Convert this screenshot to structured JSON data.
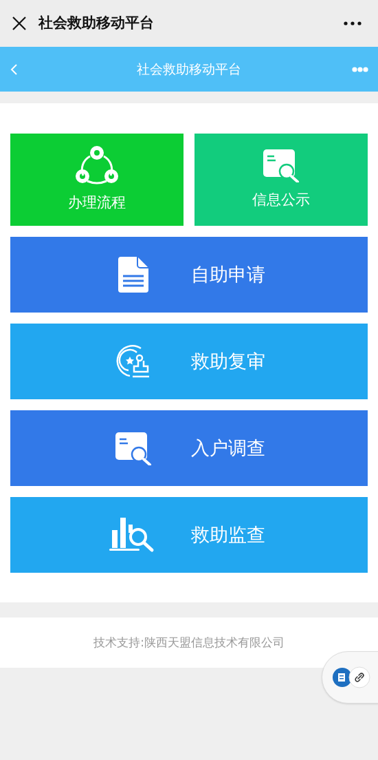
{
  "top_bar": {
    "title": "社会救助移动平台"
  },
  "header": {
    "title": "社会救助移动平台"
  },
  "tiles": [
    {
      "kind": "square",
      "label": "办理流程",
      "color": "#0ccd34"
    },
    {
      "kind": "square",
      "label": "信息公示",
      "color": "#12cc7d"
    },
    {
      "kind": "wide",
      "label": "自助申请",
      "color": "#3279e8"
    },
    {
      "kind": "wide",
      "label": "救助复审",
      "color": "#22a7f0"
    },
    {
      "kind": "wide",
      "label": "入户调查",
      "color": "#3279e8"
    },
    {
      "kind": "wide",
      "label": "救助监查",
      "color": "#22a7f0"
    }
  ],
  "footer": {
    "text": "技术支持:陕西天盟信息技术有限公司"
  }
}
